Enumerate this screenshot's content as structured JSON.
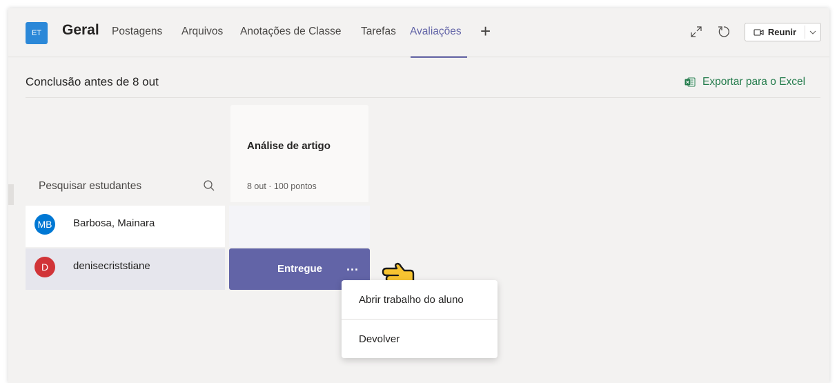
{
  "header": {
    "team_initials": "ET",
    "channel_name": "Geral",
    "tabs": [
      {
        "label": "Postagens"
      },
      {
        "label": "Arquivos"
      },
      {
        "label": "Anotações de Classe"
      },
      {
        "label": "Tarefas"
      },
      {
        "label": "Avaliações",
        "active": true
      }
    ],
    "add_tab_icon": "plus-icon",
    "icons": [
      "expand-icon",
      "refresh-icon"
    ],
    "meet_label": "Reunir"
  },
  "grades": {
    "due_title": "Conclusão antes de 8 out",
    "export_label": "Exportar para o Excel",
    "search_placeholder": "Pesquisar estudantes",
    "assignment": {
      "title": "Análise de artigo",
      "meta": "8 out · 100 pontos"
    },
    "students": [
      {
        "initials": "MB",
        "name": "Barbosa, Mainara",
        "avatar_color": "#0078d4",
        "status": ""
      },
      {
        "initials": "D",
        "name": "denisecriststiane",
        "avatar_color": "#d13438",
        "status": "Entregue"
      }
    ],
    "more_label": "...",
    "context_menu": [
      {
        "label": "Abrir trabalho do aluno"
      },
      {
        "label": "Devolver"
      }
    ]
  },
  "colors": {
    "accent": "#6264a7",
    "excel_green": "#237b4b"
  }
}
